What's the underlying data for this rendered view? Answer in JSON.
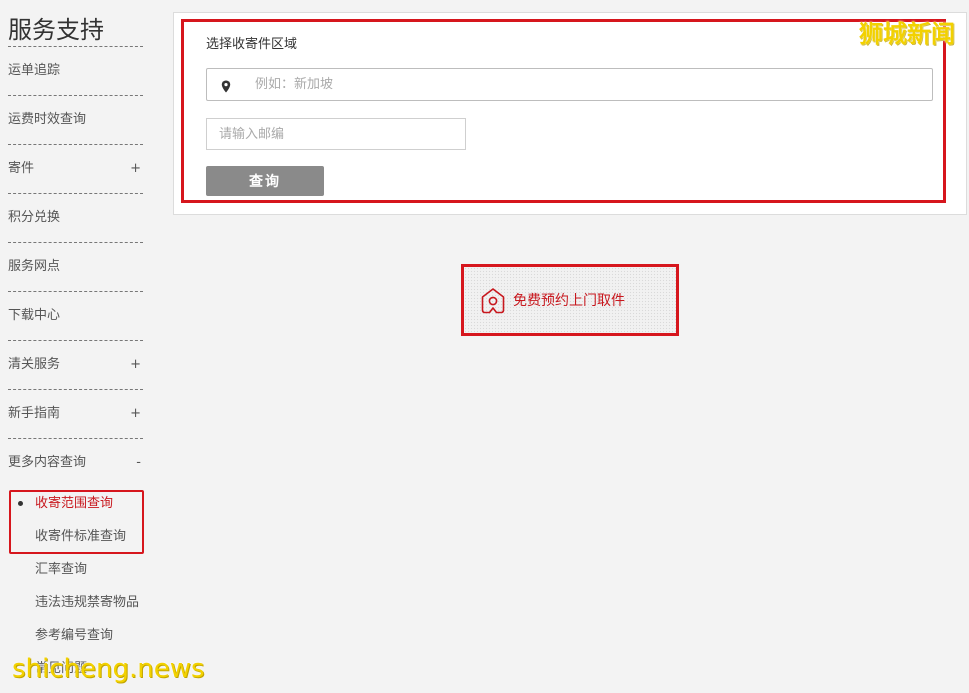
{
  "sidebar": {
    "title": "服务支持",
    "items": [
      {
        "label": "运单追踪",
        "sign": ""
      },
      {
        "label": "运费时效查询",
        "sign": ""
      },
      {
        "label": "寄件",
        "sign": "+"
      },
      {
        "label": "积分兑换",
        "sign": ""
      },
      {
        "label": "服务网点",
        "sign": ""
      },
      {
        "label": "下载中心",
        "sign": ""
      },
      {
        "label": "清关服务",
        "sign": "+"
      },
      {
        "label": "新手指南",
        "sign": "+"
      },
      {
        "label": "更多内容查询",
        "sign": "-"
      }
    ],
    "subitems": [
      {
        "label": "收寄范围查询",
        "active": true
      },
      {
        "label": "收寄件标准查询"
      },
      {
        "label": "汇率查询"
      },
      {
        "label": "违法违规禁寄物品"
      },
      {
        "label": "参考编号查询"
      },
      {
        "label": "常见问题"
      }
    ]
  },
  "main": {
    "section_label": "选择收寄件区域",
    "region_placeholder": "例如：新加坡",
    "zip_placeholder": "请输入邮编",
    "query_button": "查询"
  },
  "pickup": {
    "label": "免费预约上门取件"
  },
  "watermarks": {
    "top_right": "狮城新闻",
    "bottom_left": "shicheng.news"
  },
  "colors": {
    "accent_red": "#d6161d",
    "watermark_yellow": "#f2d100",
    "button_gray": "#8a8a8a"
  },
  "icons": [
    "map-pin-icon",
    "home-location-icon"
  ]
}
